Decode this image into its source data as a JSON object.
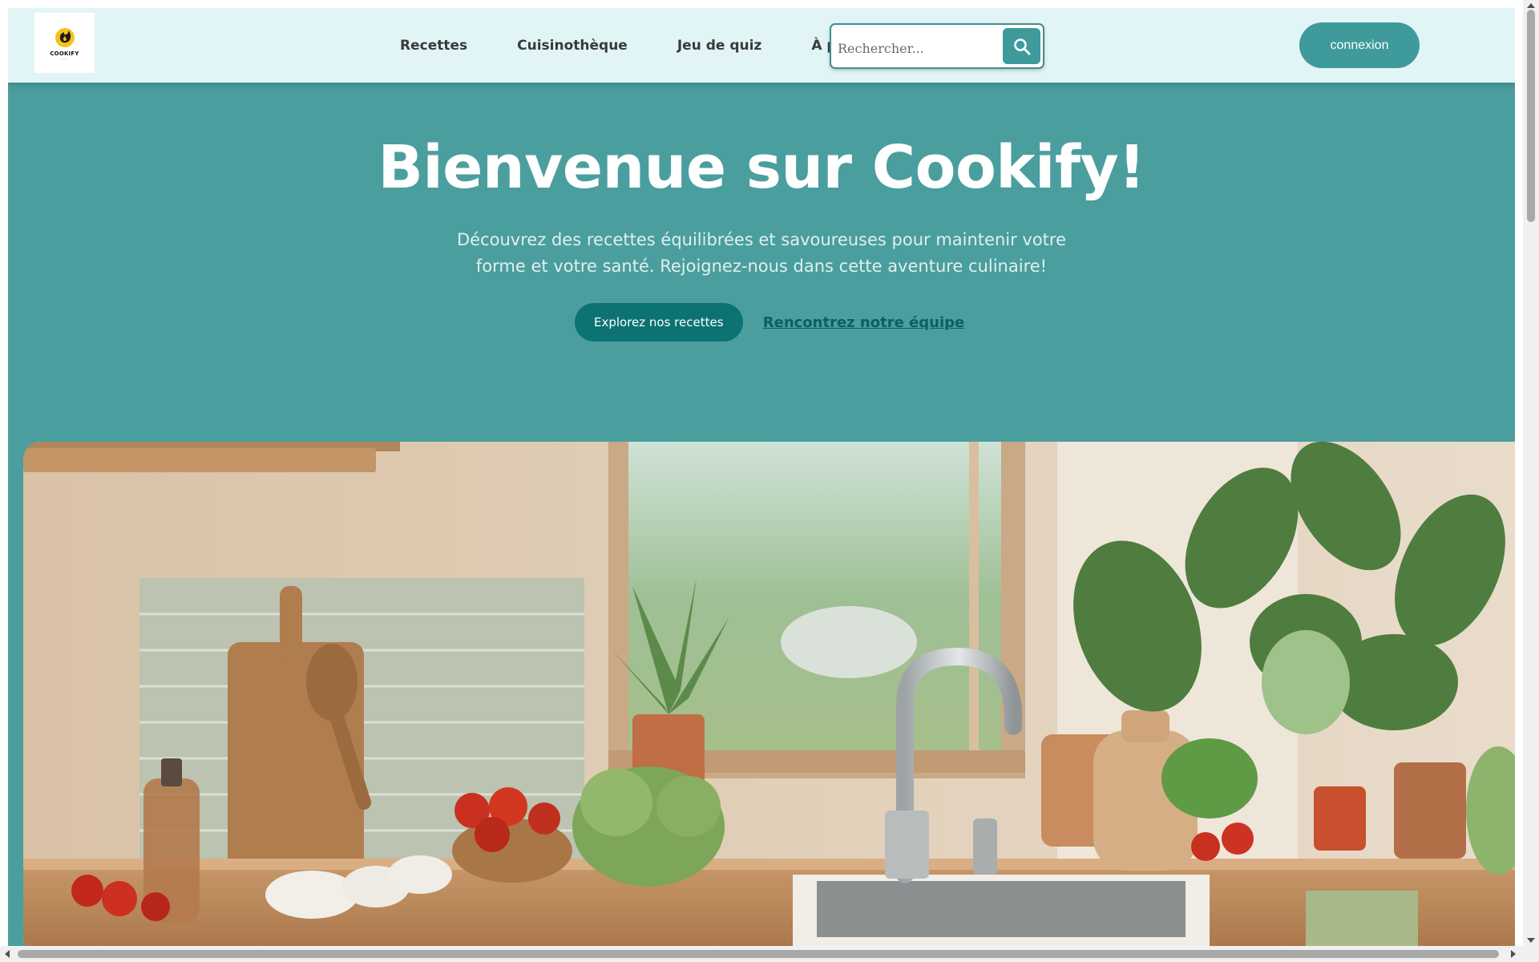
{
  "brand": {
    "logo_text": "COOKIFY",
    "logo_icon": "chef-flame-icon"
  },
  "nav": {
    "links": [
      {
        "label": "Recettes"
      },
      {
        "label": "Cuisinothèque"
      },
      {
        "label": "Jeu de quiz"
      },
      {
        "label": "À pr"
      }
    ]
  },
  "search": {
    "placeholder": "Rechercher...",
    "icon": "search-icon"
  },
  "auth": {
    "login_label": "connexion"
  },
  "hero": {
    "title": "Bienvenue sur Cookify!",
    "subtitle": "Découvrez des recettes équilibrées et savoureuses pour maintenir votre forme et votre santé. Rejoignez-nous dans cette aventure culinaire!",
    "primary_cta": "Explorez nos recettes",
    "secondary_cta": "Rencontrez notre équipe"
  },
  "colors": {
    "navbar_bg": "#e2f5f6",
    "hero_bg": "#4b9e9e",
    "accent": "#3f9a9b",
    "primary_button": "#0c7372",
    "link": "#0d5f5f"
  }
}
